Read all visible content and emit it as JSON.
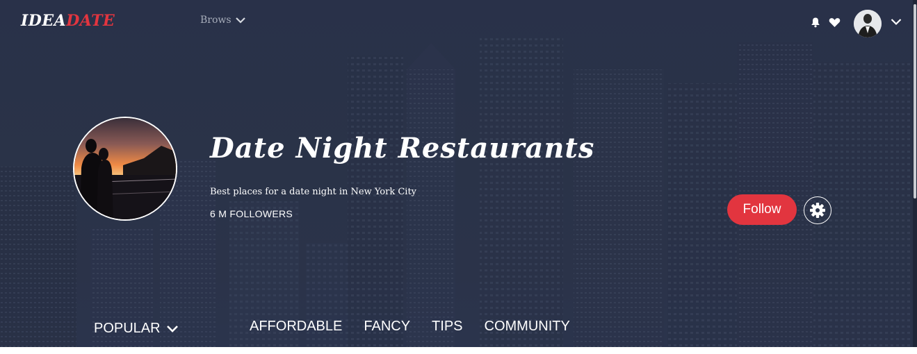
{
  "header": {
    "logo_part1": "IDEA",
    "logo_part2": "DATE",
    "browse_label": "Brows",
    "notifications_icon": "bell-icon",
    "favorites_icon": "heart-icon",
    "user_menu_icon": "chevron-down-icon"
  },
  "board": {
    "title": "Date Night Restaurants",
    "description": "Best places for a date night in New York City",
    "followers": "6 M FOLLOWERS",
    "follow_label": "Follow",
    "settings_icon": "gear-icon"
  },
  "subnav": {
    "sort_label": "POPULAR",
    "tabs": [
      "AFFORDABLE",
      "FANCY",
      "TIPS",
      "COMMUNITY"
    ]
  },
  "colors": {
    "accent": "#e2353f",
    "background": "#2a3349",
    "text": "#ffffff"
  }
}
